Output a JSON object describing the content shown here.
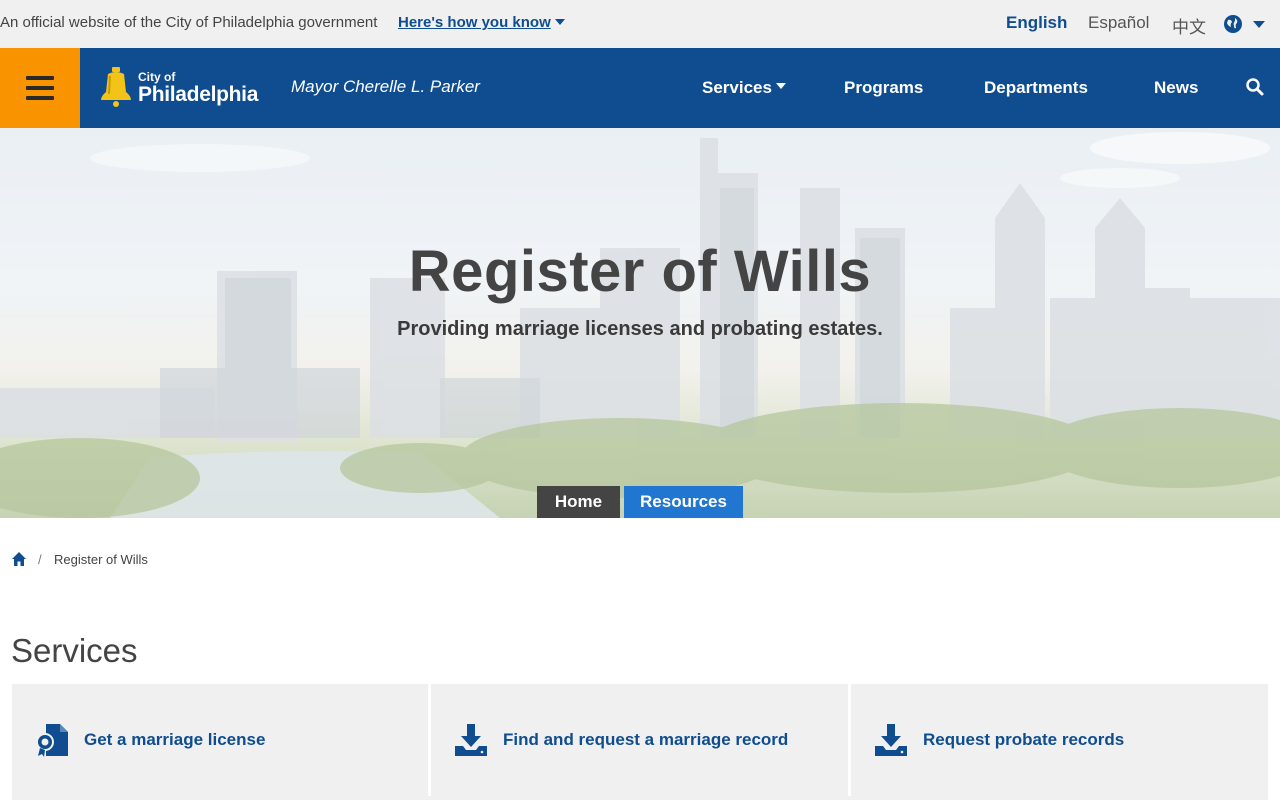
{
  "banner": {
    "official_text": "An official website of the City of Philadelphia government",
    "how_you_know": "Here's how you know",
    "languages": [
      "English",
      "Español",
      "中文"
    ]
  },
  "header": {
    "logo_small": "City of",
    "logo_big": "Philadelphia",
    "mayor": "Mayor Cherelle L. Parker",
    "nav": [
      "Services",
      "Programs",
      "Departments",
      "News"
    ]
  },
  "hero": {
    "title": "Register of Wills",
    "subtitle": "Providing marriage licenses and probating estates.",
    "tabs": [
      "Home",
      "Resources"
    ]
  },
  "breadcrumb": {
    "separator": "/",
    "current": "Register of Wills"
  },
  "services": {
    "heading": "Services",
    "cards": [
      {
        "label": "Get a marriage license",
        "icon": "license-certificate-icon"
      },
      {
        "label": "Find and request a marriage record",
        "icon": "download-icon"
      },
      {
        "label": "Request probate records",
        "icon": "download-icon"
      }
    ]
  },
  "colors": {
    "brand_blue": "#0f4d90",
    "accent_orange": "#f99300",
    "tab_dark": "#444444",
    "tab_active": "#2176d2"
  }
}
